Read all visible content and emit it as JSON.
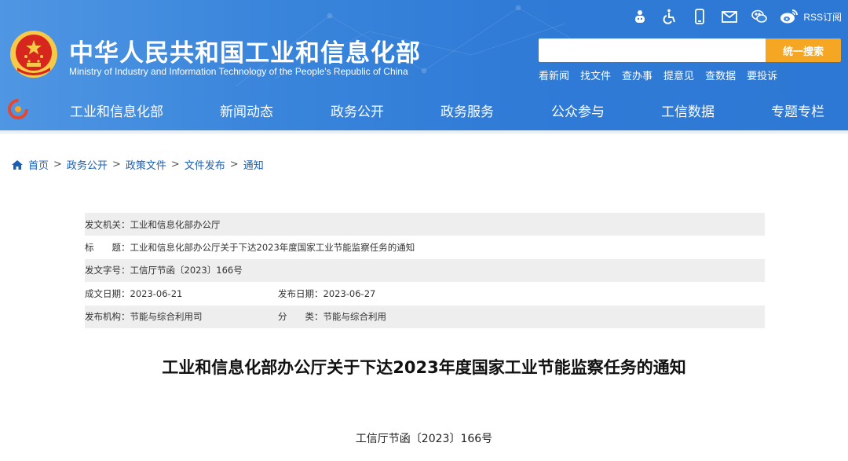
{
  "header": {
    "site_title": "中华人民共和国工业和信息化部",
    "site_subtitle": "Ministry of Industry and Information Technology of the People's Republic of China",
    "top_icons": [
      "robot-assistant-icon",
      "accessibility-icon",
      "mobile-icon",
      "mail-icon",
      "wechat-icon",
      "weibo-icon"
    ],
    "rss_label": "RSS订阅",
    "search": {
      "placeholder": "",
      "button_label": "统一搜索"
    },
    "quick_links": [
      "看新闻",
      "找文件",
      "查办事",
      "提意见",
      "查数据",
      "要投诉"
    ],
    "nav": [
      "工业和信息化部",
      "新闻动态",
      "政务公开",
      "政务服务",
      "公众参与",
      "工信数据",
      "专题专栏"
    ],
    "colors": {
      "header_blue": "#3b86dc",
      "search_orange": "#f5a623",
      "emblem_red": "#d7261e",
      "emblem_gold": "#f7c948"
    }
  },
  "breadcrumb": [
    "首页",
    "政务公开",
    "政策文件",
    "文件发布",
    "通知"
  ],
  "info": {
    "issuer_label": "发文机关：",
    "issuer": "工业和信息化部办公厅",
    "title_label": "标　　题：",
    "title": "工业和信息化部办公厅关于下达2023年度国家工业节能监察任务的通知",
    "docno_label": "发文字号：",
    "docno": "工信厅节函〔2023〕166号",
    "created_label": "成文日期：",
    "created": "2023-06-21",
    "published_label": "发布日期：",
    "published": "2023-06-27",
    "org_label": "发布机构：",
    "org": "节能与综合利用司",
    "category_label": "分　　类：",
    "category": "节能与综合利用"
  },
  "article": {
    "title": "工业和信息化部办公厅关于下达2023年度国家工业节能监察任务的通知",
    "doc_number": "工信厅节函〔2023〕166号"
  }
}
